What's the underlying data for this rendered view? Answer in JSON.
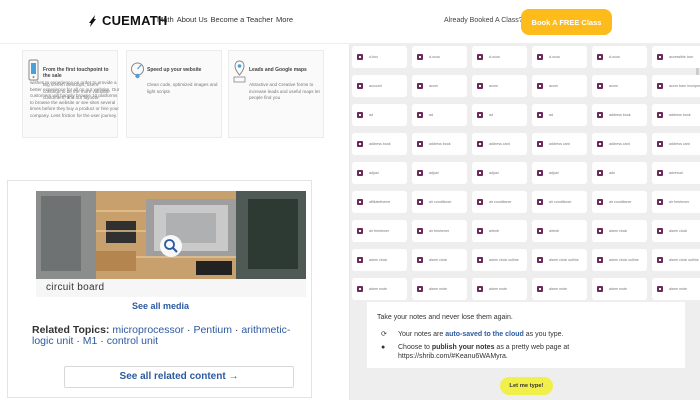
{
  "header": {
    "logo_text": "CUEMATH",
    "nav": [
      "Math",
      "About Us",
      "Become a Teacher",
      "More"
    ],
    "booked_text": "Already Booked A Class?",
    "book_button": "Book A FREE Class",
    "accent": "#fdbb1c"
  },
  "features": [
    {
      "title": "From the first touchpoint to the sale",
      "desc": "Big screen desktops, users continue to be the more valuable customers, and our layouts"
    },
    {
      "title": "Speed up your website",
      "desc": "Clean code, optimized images and light scripts"
    },
    {
      "title": "Leads and Google maps",
      "desc": "Attractive and Creative forms to increase leads and useful maps let people find you"
    }
  ],
  "feature_long_desc": "wishes to experience on order to provide a better experience for all on our website. Our customers will happily browse 10 platforms to browse the website or see sites several times before they buy a product or hire your company. Less friction for the user journey.",
  "media": {
    "caption": "circuit board",
    "see_all_media": "See all media",
    "related_heading": "Related Topics:",
    "related_topics": [
      "microprocessor",
      "Pentium",
      "arithmetic-logic unit",
      "M1",
      "control unit"
    ],
    "see_all_related": "See all related content →"
  },
  "icon_grid": [
    {
      "label": "d-box",
      "icon": "cube-icon",
      "color": "#6a2a5a"
    },
    {
      "label": "d-ocus",
      "icon": "focus-icon",
      "color": "#6a2a5a"
    },
    {
      "label": "d-ocus",
      "icon": "focus-icon",
      "color": "#6a2a5a"
    },
    {
      "label": "d-ocus",
      "icon": "focus-icon",
      "color": "#6a2a5a"
    },
    {
      "label": "d-ocus",
      "icon": "focus-icon",
      "color": "#6a2a5a"
    },
    {
      "label": "accessible icon",
      "icon": "accessible-icon",
      "color": "#6a2a5a"
    },
    {
      "label": "account",
      "icon": "account-icon",
      "color": "#6a2a5a"
    },
    {
      "label": "acorn",
      "icon": "acorn-icon",
      "color": "#6a2a5a"
    },
    {
      "label": "acorn",
      "icon": "acorn-icon",
      "color": "#6a2a5a"
    },
    {
      "label": "acorn",
      "icon": "acorn-icon",
      "color": "#6a2a5a"
    },
    {
      "label": "acorn",
      "icon": "acorn-icon",
      "color": "#6a2a5a"
    },
    {
      "label": "acorn barn incorporated",
      "icon": "barn-icon",
      "color": "#6a2a5a"
    },
    {
      "label": "ad",
      "icon": "ad-icon",
      "color": "#6a2a5a"
    },
    {
      "label": "ad",
      "icon": "ad-icon",
      "color": "#6a2a5a"
    },
    {
      "label": "ad",
      "icon": "ad-icon",
      "color": "#6a2a5a"
    },
    {
      "label": "ad",
      "icon": "ad-icon",
      "color": "#6a2a5a"
    },
    {
      "label": "address book",
      "icon": "address-book-icon",
      "color": "#6a2a5a"
    },
    {
      "label": "address book",
      "icon": "address-book-icon",
      "color": "#6a2a5a"
    },
    {
      "label": "address book",
      "icon": "address-book-icon",
      "color": "#6a2a5a"
    },
    {
      "label": "address book",
      "icon": "address-book-icon",
      "color": "#6a2a5a"
    },
    {
      "label": "address card",
      "icon": "address-card-icon",
      "color": "#6a2a5a"
    },
    {
      "label": "address card",
      "icon": "address-card-icon",
      "color": "#6a2a5a"
    },
    {
      "label": "address card",
      "icon": "address-card-icon",
      "color": "#6a2a5a"
    },
    {
      "label": "address card",
      "icon": "address-card-icon",
      "color": "#6a2a5a"
    },
    {
      "label": "adjust",
      "icon": "adjust-icon",
      "color": "#6a2a5a"
    },
    {
      "label": "adjust",
      "icon": "adjust-icon",
      "color": "#6a2a5a"
    },
    {
      "label": "adjust",
      "icon": "adjust-icon",
      "color": "#6a2a5a"
    },
    {
      "label": "adjust",
      "icon": "adjust-icon",
      "color": "#6a2a5a"
    },
    {
      "label": "adn",
      "icon": "adn-icon",
      "color": "#6a2a5a"
    },
    {
      "label": "adversal",
      "icon": "adversal-icon",
      "color": "#6a2a5a"
    },
    {
      "label": "affiliatetheme",
      "icon": "affiliatetheme-icon",
      "color": "#6a2a5a"
    },
    {
      "label": "air conditioner",
      "icon": "air-conditioner-icon",
      "color": "#6a2a5a"
    },
    {
      "label": "air conditioner",
      "icon": "air-conditioner-icon",
      "color": "#6a2a5a"
    },
    {
      "label": "air conditioner",
      "icon": "air-conditioner-icon",
      "color": "#6a2a5a"
    },
    {
      "label": "air conditioner",
      "icon": "air-conditioner-icon",
      "color": "#6a2a5a"
    },
    {
      "label": "air freshener",
      "icon": "air-freshener-icon",
      "color": "#6a2a5a"
    },
    {
      "label": "air freshener",
      "icon": "air-freshener-icon",
      "color": "#6a2a5a"
    },
    {
      "label": "air freshener",
      "icon": "air-freshener-icon",
      "color": "#6a2a5a"
    },
    {
      "label": "airbnb",
      "icon": "airbnb-icon",
      "color": "#6a2a5a"
    },
    {
      "label": "airbnb",
      "icon": "airbnb-icon",
      "color": "#6a2a5a"
    },
    {
      "label": "alarm clock",
      "icon": "alarm-clock-icon",
      "color": "#6a2a5a"
    },
    {
      "label": "alarm clock",
      "icon": "alarm-clock-icon",
      "color": "#6a2a5a"
    },
    {
      "label": "alarm clock",
      "icon": "alarm-clock-icon",
      "color": "#6a2a5a"
    },
    {
      "label": "alarm clock",
      "icon": "alarm-clock-icon",
      "color": "#6a2a5a"
    },
    {
      "label": "alarm clock outline",
      "icon": "alarm-clock-icon",
      "color": "#6a2a5a"
    },
    {
      "label": "alarm clock outline",
      "icon": "alarm-clock-icon",
      "color": "#6a2a5a"
    },
    {
      "label": "alarm clock outline",
      "icon": "alarm-clock-icon",
      "color": "#6a2a5a"
    },
    {
      "label": "alarm clock outline",
      "icon": "alarm-clock-icon",
      "color": "#6a2a5a"
    },
    {
      "label": "alarm mute",
      "icon": "alarm-mute-icon",
      "color": "#6a2a5a"
    },
    {
      "label": "alarm mute",
      "icon": "alarm-mute-icon",
      "color": "#6a2a5a"
    },
    {
      "label": "alarm mute",
      "icon": "alarm-mute-icon",
      "color": "#6a2a5a"
    },
    {
      "label": "alarm mute",
      "icon": "alarm-mute-icon",
      "color": "#6a2a5a"
    },
    {
      "label": "alarm mute",
      "icon": "alarm-mute-icon",
      "color": "#6a2a5a"
    },
    {
      "label": "alarm mute",
      "icon": "alarm-mute-icon",
      "color": "#6a2a5a"
    }
  ],
  "notes": {
    "line1": "Take your notes and never lose them again.",
    "autosave_pre": "Your notes are ",
    "autosave_bold": "auto-saved to the cloud",
    "autosave_post": " as you type.",
    "publish_pre": "Choose to ",
    "publish_bold": "publish your notes",
    "publish_post": " as a pretty web page at",
    "url": "https://shrib.com/#Keanu6WAMyra.",
    "button": "Let me type!",
    "button_color": "#f1ef4a"
  }
}
